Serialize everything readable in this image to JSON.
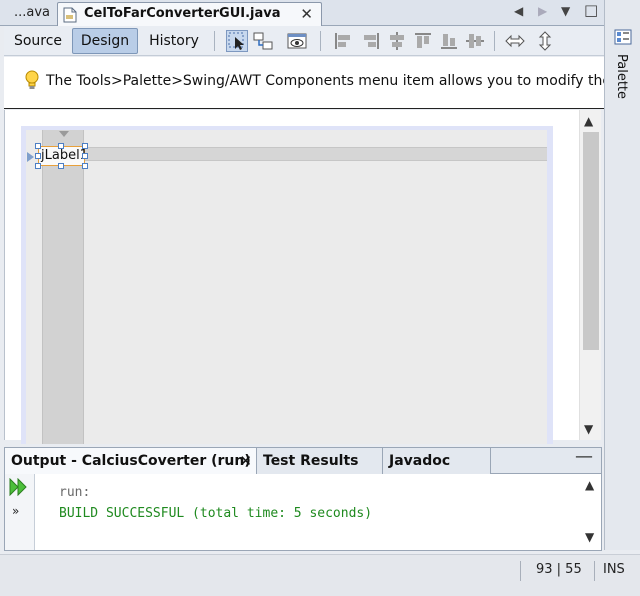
{
  "editor_tabs": {
    "previous": "...ava",
    "active": "CelToFarConverterGUI.java",
    "close_glyph": "✕",
    "scroll_left": "◀",
    "scroll_right": "▶",
    "dropdown": "▼",
    "restore": "□"
  },
  "toolbar": {
    "source_label": "Source",
    "design_label": "Design",
    "history_label": "History"
  },
  "hint": {
    "text": "The Tools>Palette>Swing/AWT Components menu item allows you to modify the content"
  },
  "design_form": {
    "label_text": "jLabel1"
  },
  "palette": {
    "label": "Palette"
  },
  "output": {
    "tab_output": "Output - CalciusCoverter (run)",
    "tab_tests": "Test Results",
    "tab_javadoc": "Javadoc",
    "close_glyph": "✕",
    "minimize_glyph": "—",
    "more_glyph": "»",
    "lines": {
      "run": "run:",
      "build": "BUILD SUCCESSFUL (total time: 5 seconds)"
    }
  },
  "scroll": {
    "up": "▲",
    "down": "▼"
  },
  "status": {
    "position": "93 | 55",
    "mode": "INS"
  },
  "colors": {
    "selection_highlight": "#b9cde7",
    "build_success": "#1f8a1f",
    "component_border": "#e8a03a",
    "form_outline": "#dfe3f8"
  },
  "icons": {
    "file": "java-file-icon",
    "hint": "lightbulb-icon",
    "palette": "palette-icon",
    "rerun": "rerun-icon"
  }
}
